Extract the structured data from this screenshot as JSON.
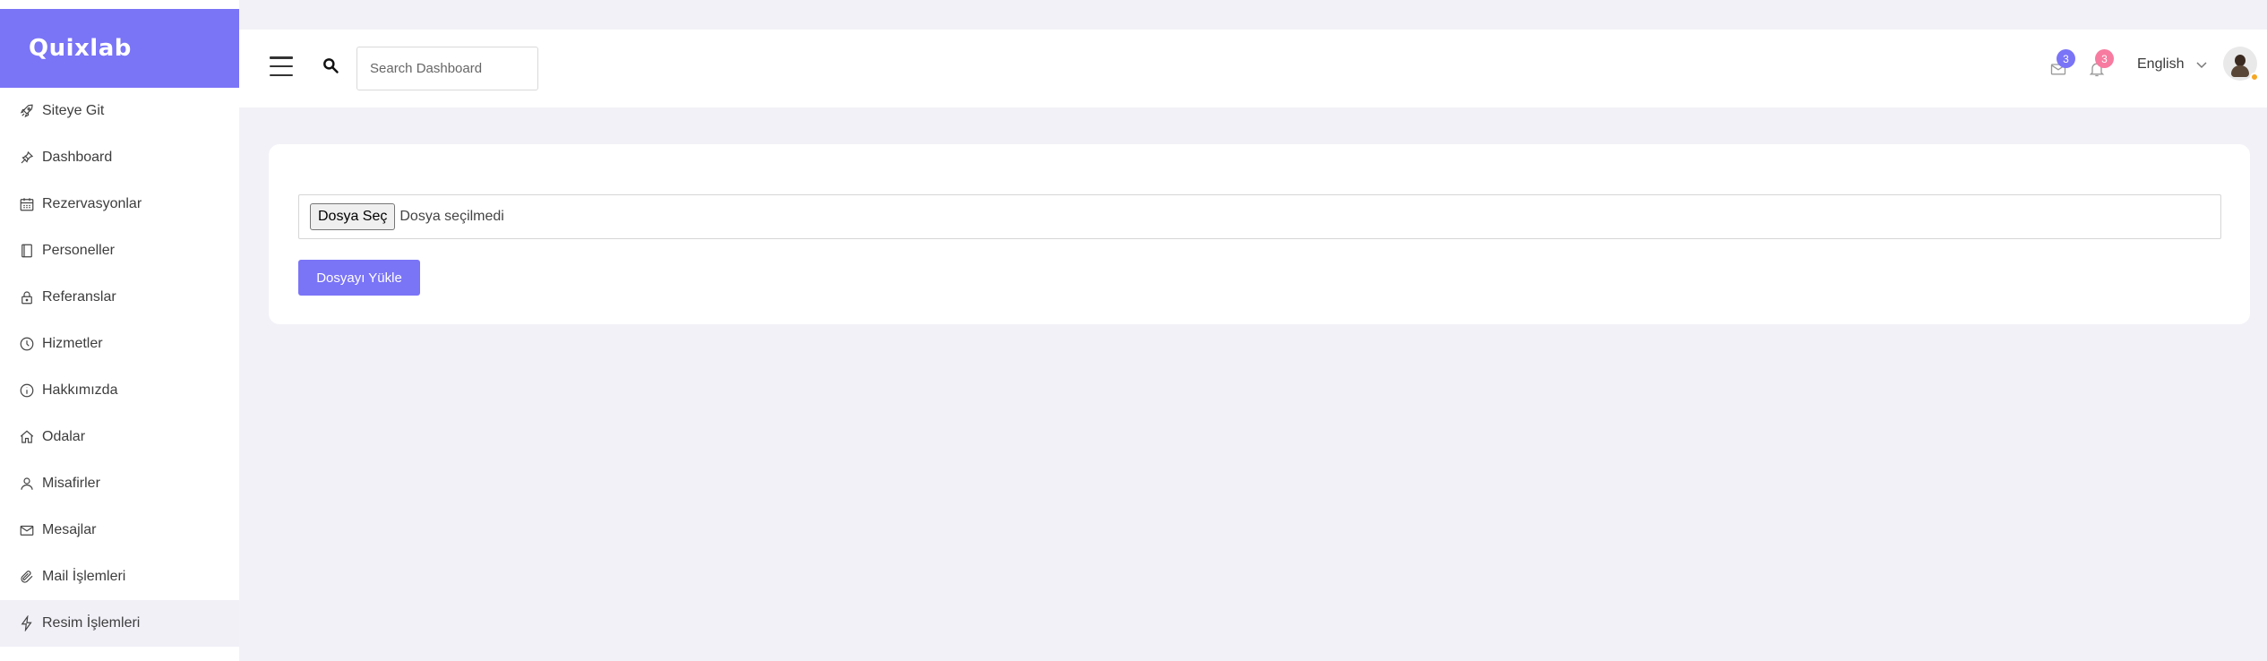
{
  "brand": {
    "name": "Quixlab"
  },
  "sidebar": {
    "items": [
      {
        "label": "Siteye Git",
        "icon": "rocket-icon"
      },
      {
        "label": "Dashboard",
        "icon": "pin-icon"
      },
      {
        "label": "Rezervasyonlar",
        "icon": "calendar-icon"
      },
      {
        "label": "Personeller",
        "icon": "book-icon"
      },
      {
        "label": "Referanslar",
        "icon": "lock-icon"
      },
      {
        "label": "Hizmetler",
        "icon": "clock-icon"
      },
      {
        "label": "Hakkımızda",
        "icon": "info-icon"
      },
      {
        "label": "Odalar",
        "icon": "home-icon"
      },
      {
        "label": "Misafirler",
        "icon": "user-icon"
      },
      {
        "label": "Mesajlar",
        "icon": "envelope-icon"
      },
      {
        "label": "Mail İşlemleri",
        "icon": "paperclip-icon"
      },
      {
        "label": "Resim İşlemleri",
        "icon": "lightning-icon",
        "active": true
      }
    ]
  },
  "header": {
    "search_placeholder": "Search Dashboard",
    "messages_count": "3",
    "notifications_count": "3",
    "language": "English"
  },
  "upload": {
    "choose_file_label": "Dosya Seç",
    "no_file_text": "Dosya seçilmedi",
    "upload_button_label": "Dosyayı Yükle"
  },
  "colors": {
    "accent": "#7a74f7",
    "badge_pink": "#f77ba0",
    "background": "#f2f1f7"
  }
}
